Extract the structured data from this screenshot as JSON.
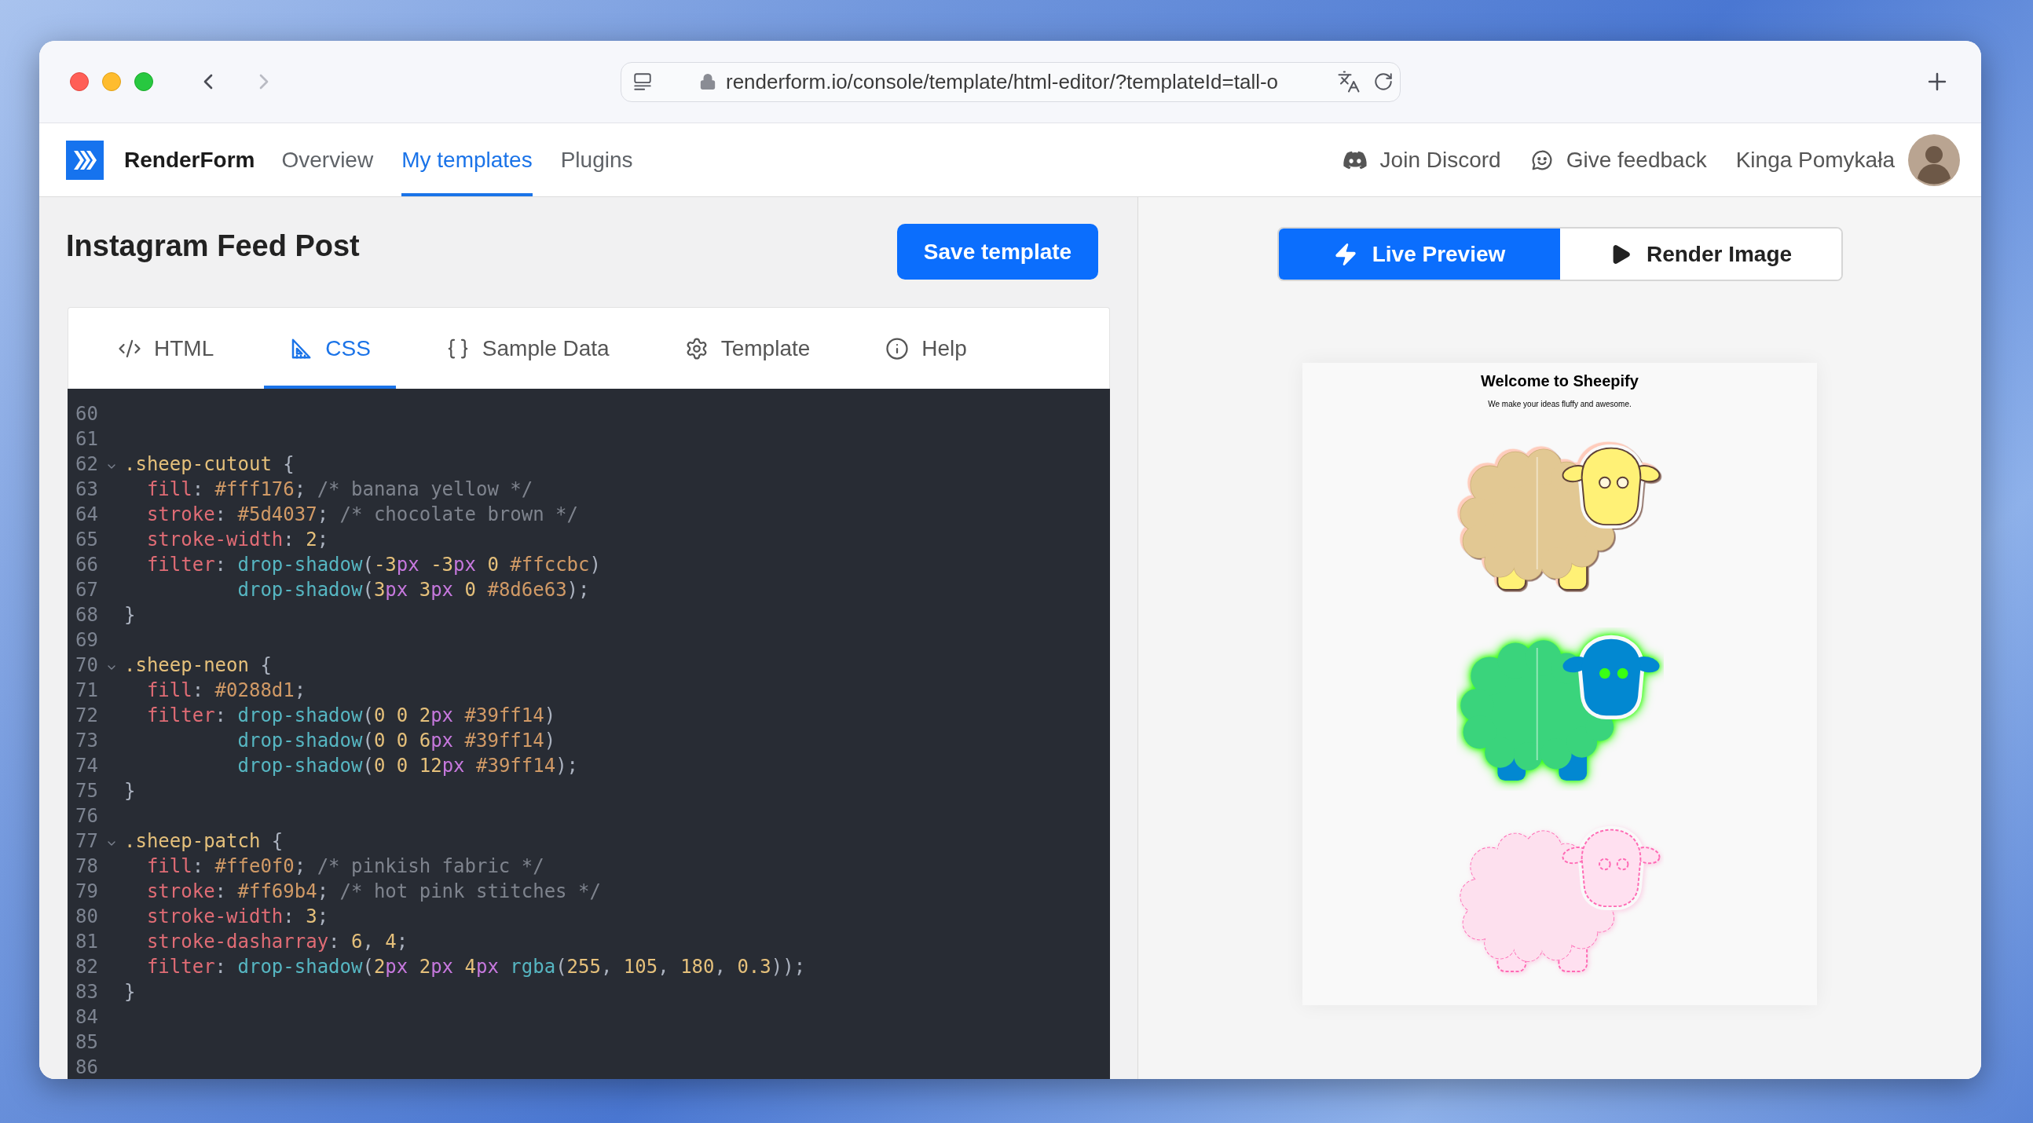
{
  "browser": {
    "nav_buttons": [
      {
        "kind": "back",
        "disabled": false
      },
      {
        "kind": "forward",
        "disabled": true
      }
    ],
    "url": "renderform.io/console/template/html-editor/?templateId=tall-o"
  },
  "header": {
    "brand": "RenderForm",
    "nav": [
      {
        "label": "Overview",
        "selected": false
      },
      {
        "label": "My templates",
        "selected": true
      },
      {
        "label": "Plugins",
        "selected": false
      }
    ],
    "links": [
      {
        "kind": "discord",
        "label": "Join Discord"
      },
      {
        "kind": "feedback",
        "label": "Give feedback"
      }
    ],
    "user": {
      "name": "Kinga Pomykała"
    }
  },
  "editor": {
    "title": "Instagram Feed Post",
    "save_button": "Save template",
    "tabs": [
      {
        "label": "HTML",
        "selected": false
      },
      {
        "label": "CSS",
        "selected": true
      },
      {
        "label": "Sample Data",
        "selected": false
      },
      {
        "label": "Template",
        "selected": false
      },
      {
        "label": "Help",
        "selected": false
      }
    ],
    "code_lines": [
      {
        "number": "60",
        "foldable": false
      },
      {
        "number": "61",
        "foldable": false
      },
      {
        "number": "62",
        "foldable": true,
        "text": ".sheep-cutout {"
      },
      {
        "number": "63",
        "foldable": false,
        "text": "  fill: #fff176; /* banana yellow */"
      },
      {
        "number": "64",
        "foldable": false,
        "text": "  stroke: #5d4037; /* chocolate brown */"
      },
      {
        "number": "65",
        "foldable": false,
        "text": "  stroke-width: 2;"
      },
      {
        "number": "66",
        "foldable": false,
        "text": "  filter: drop-shadow(-3px -3px 0 #ffccbc)"
      },
      {
        "number": "67",
        "foldable": false,
        "text": "          drop-shadow(3px 3px 0 #8d6e63);"
      },
      {
        "number": "68",
        "foldable": false,
        "text": "}"
      },
      {
        "number": "69",
        "foldable": false
      },
      {
        "number": "70",
        "foldable": true,
        "text": ".sheep-neon {"
      },
      {
        "number": "71",
        "foldable": false,
        "text": "  fill: #0288d1;"
      },
      {
        "number": "72",
        "foldable": false,
        "text": "  filter: drop-shadow(0 0 2px #39ff14)"
      },
      {
        "number": "73",
        "foldable": false,
        "text": "          drop-shadow(0 0 6px #39ff14)"
      },
      {
        "number": "74",
        "foldable": false,
        "text": "          drop-shadow(0 0 12px #39ff14);"
      },
      {
        "number": "75",
        "foldable": false,
        "text": "}"
      },
      {
        "number": "76",
        "foldable": false
      },
      {
        "number": "77",
        "foldable": true,
        "text": ".sheep-patch {"
      },
      {
        "number": "78",
        "foldable": false,
        "text": "  fill: #ffe0f0; /* pinkish fabric */"
      },
      {
        "number": "79",
        "foldable": false,
        "text": "  stroke: #ff69b4; /* hot pink stitches */"
      },
      {
        "number": "80",
        "foldable": false,
        "text": "  stroke-width: 3;"
      },
      {
        "number": "81",
        "foldable": false,
        "text": "  stroke-dasharray: 6, 4;"
      },
      {
        "number": "82",
        "foldable": false,
        "text": "  filter: drop-shadow(2px 2px 4px rgba(255, 105, 180, 0.3));"
      },
      {
        "number": "83",
        "foldable": false,
        "text": "}"
      },
      {
        "number": "84",
        "foldable": false
      },
      {
        "number": "85",
        "foldable": false
      },
      {
        "number": "86",
        "foldable": false
      }
    ]
  },
  "preview": {
    "modes": [
      {
        "kind": "live",
        "label": "Live Preview",
        "selected": true
      },
      {
        "kind": "render",
        "label": "Render Image",
        "selected": false
      }
    ],
    "canvas": {
      "title": "Welcome to Sheepify",
      "subtitle": "We make your ideas fluffy and awesome.",
      "sheep": [
        {
          "kind": "cutout"
        },
        {
          "kind": "neon"
        },
        {
          "kind": "patch"
        }
      ]
    }
  }
}
